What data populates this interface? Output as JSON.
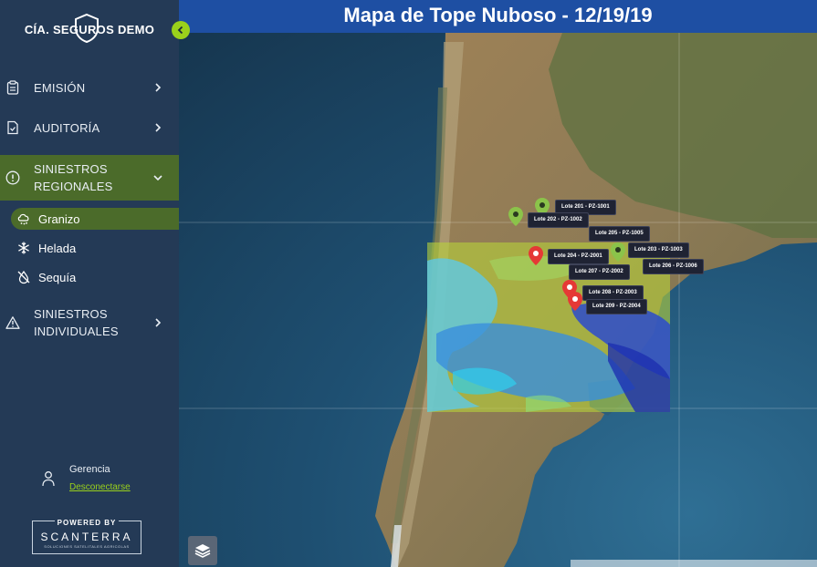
{
  "brand": {
    "name": "CÍA. SEGUROS DEMO"
  },
  "header": {
    "title": "Mapa de Tope Nuboso - 12/19/19"
  },
  "nav": {
    "emision": "EMISIÓN",
    "auditoria": "AUDITORÍA",
    "siniestros_regionales_1": "SINIESTROS",
    "siniestros_regionales_2": "REGIONALES",
    "sub": {
      "granizo": "Granizo",
      "helada": "Helada",
      "sequia": "Sequía"
    },
    "siniestros_individuales_1": "SINIESTROS",
    "siniestros_individuales_2": "INDIVIDUALES"
  },
  "user": {
    "name": "Gerencia",
    "logout": "Desconectarse"
  },
  "powered": {
    "label": "POWERED BY",
    "name": "SCANTERRA",
    "tagline": "SOLUCIONES SATELITALES AGRICOLAS"
  },
  "map": {
    "lot_labels": {
      "l201": "Lote 201 - PZ-1001",
      "l202": "Lote 202 - PZ-1002",
      "l203": "Lote 203 - PZ-1003",
      "l204": "Lote 204 - PZ-2001",
      "l205": "Lote 205 - PZ-1005",
      "l206": "Lote 206 - PZ-1006",
      "l207": "Lote 207 - PZ-2002",
      "l208": "Lote 208 - PZ-2003",
      "l209": "Lote 209 - PZ-2004"
    }
  },
  "colors": {
    "accent": "#9ad11b",
    "header": "#1e4fa3",
    "sidebar": "#243a56",
    "active": "#4b6b2a",
    "pin_green": "#8bc34a",
    "pin_red": "#e53935"
  }
}
